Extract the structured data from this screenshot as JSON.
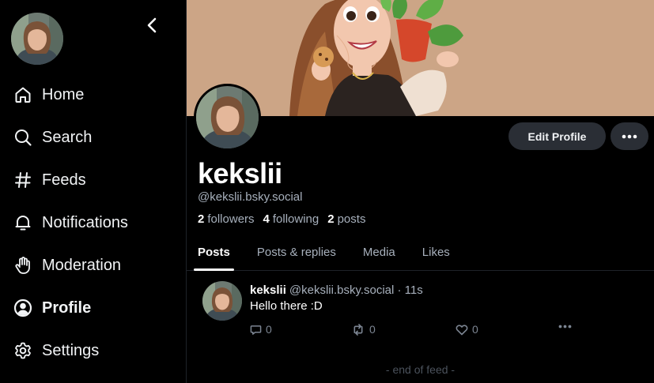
{
  "sidebar": {
    "items": [
      {
        "label": "Home",
        "icon": "home-icon"
      },
      {
        "label": "Search",
        "icon": "search-icon"
      },
      {
        "label": "Feeds",
        "icon": "hash-icon"
      },
      {
        "label": "Notifications",
        "icon": "bell-icon"
      },
      {
        "label": "Moderation",
        "icon": "hand-icon"
      },
      {
        "label": "Profile",
        "icon": "user-circle-icon",
        "active": true
      },
      {
        "label": "Settings",
        "icon": "gear-icon"
      }
    ]
  },
  "profile": {
    "display_name": "kekslii",
    "handle": "@kekslii.bsky.social",
    "followers_count": "2",
    "followers_label": "followers",
    "following_count": "4",
    "following_label": "following",
    "posts_count": "2",
    "posts_label": "posts",
    "edit_label": "Edit Profile"
  },
  "tabs": [
    "Posts",
    "Posts & replies",
    "Media",
    "Likes"
  ],
  "post": {
    "author": "kekslii",
    "meta": "@kekslii.bsky.social · 11s",
    "text": "Hello there :D",
    "reply_count": "0",
    "repost_count": "0",
    "like_count": "0"
  },
  "feed_end": "- end of feed -",
  "colors": {
    "background": "#000000",
    "muted": "#a7b0bc",
    "button_bg": "#2a2e35",
    "banner": "#c9a283"
  }
}
